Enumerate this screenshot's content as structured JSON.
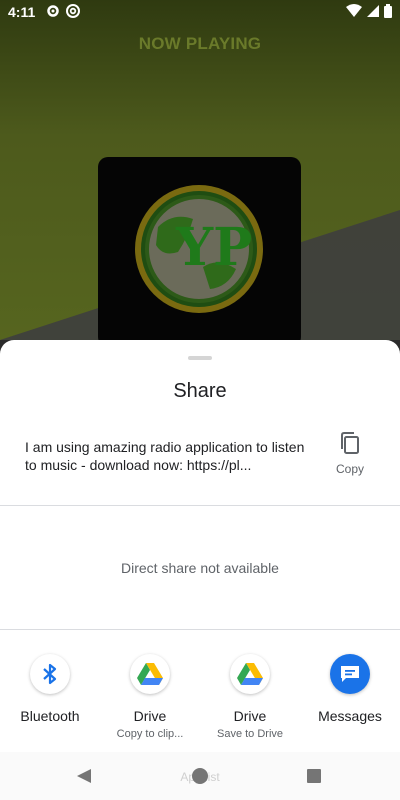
{
  "status_bar": {
    "time": "4:11",
    "icons_left": [
      "gear-icon",
      "at-sign-icon"
    ],
    "icons_right": [
      "wifi-icon",
      "cellular-signal-icon",
      "battery-icon"
    ]
  },
  "player": {
    "title": "NOW PLAYING",
    "album_art_letters": "YP"
  },
  "share_sheet": {
    "title": "Share",
    "share_text": "I am using amazing radio application to listen to music - download now: https://pl...",
    "copy_label": "Copy",
    "direct_share_message": "Direct share not available",
    "apps": [
      {
        "name": "Bluetooth",
        "sub": "",
        "icon": "bluetooth-icon"
      },
      {
        "name": "Drive",
        "sub": "Copy to clip...",
        "icon": "google-drive-icon"
      },
      {
        "name": "Drive",
        "sub": "Save to Drive",
        "icon": "google-drive-icon"
      },
      {
        "name": "Messages",
        "sub": "",
        "icon": "messages-icon"
      }
    ]
  },
  "nav_bar": {
    "ghost_text": "App list"
  },
  "colors": {
    "accent_blue": "#1a73e8",
    "messages_blue": "#1a73e8",
    "bg_olive": "#56651f"
  }
}
